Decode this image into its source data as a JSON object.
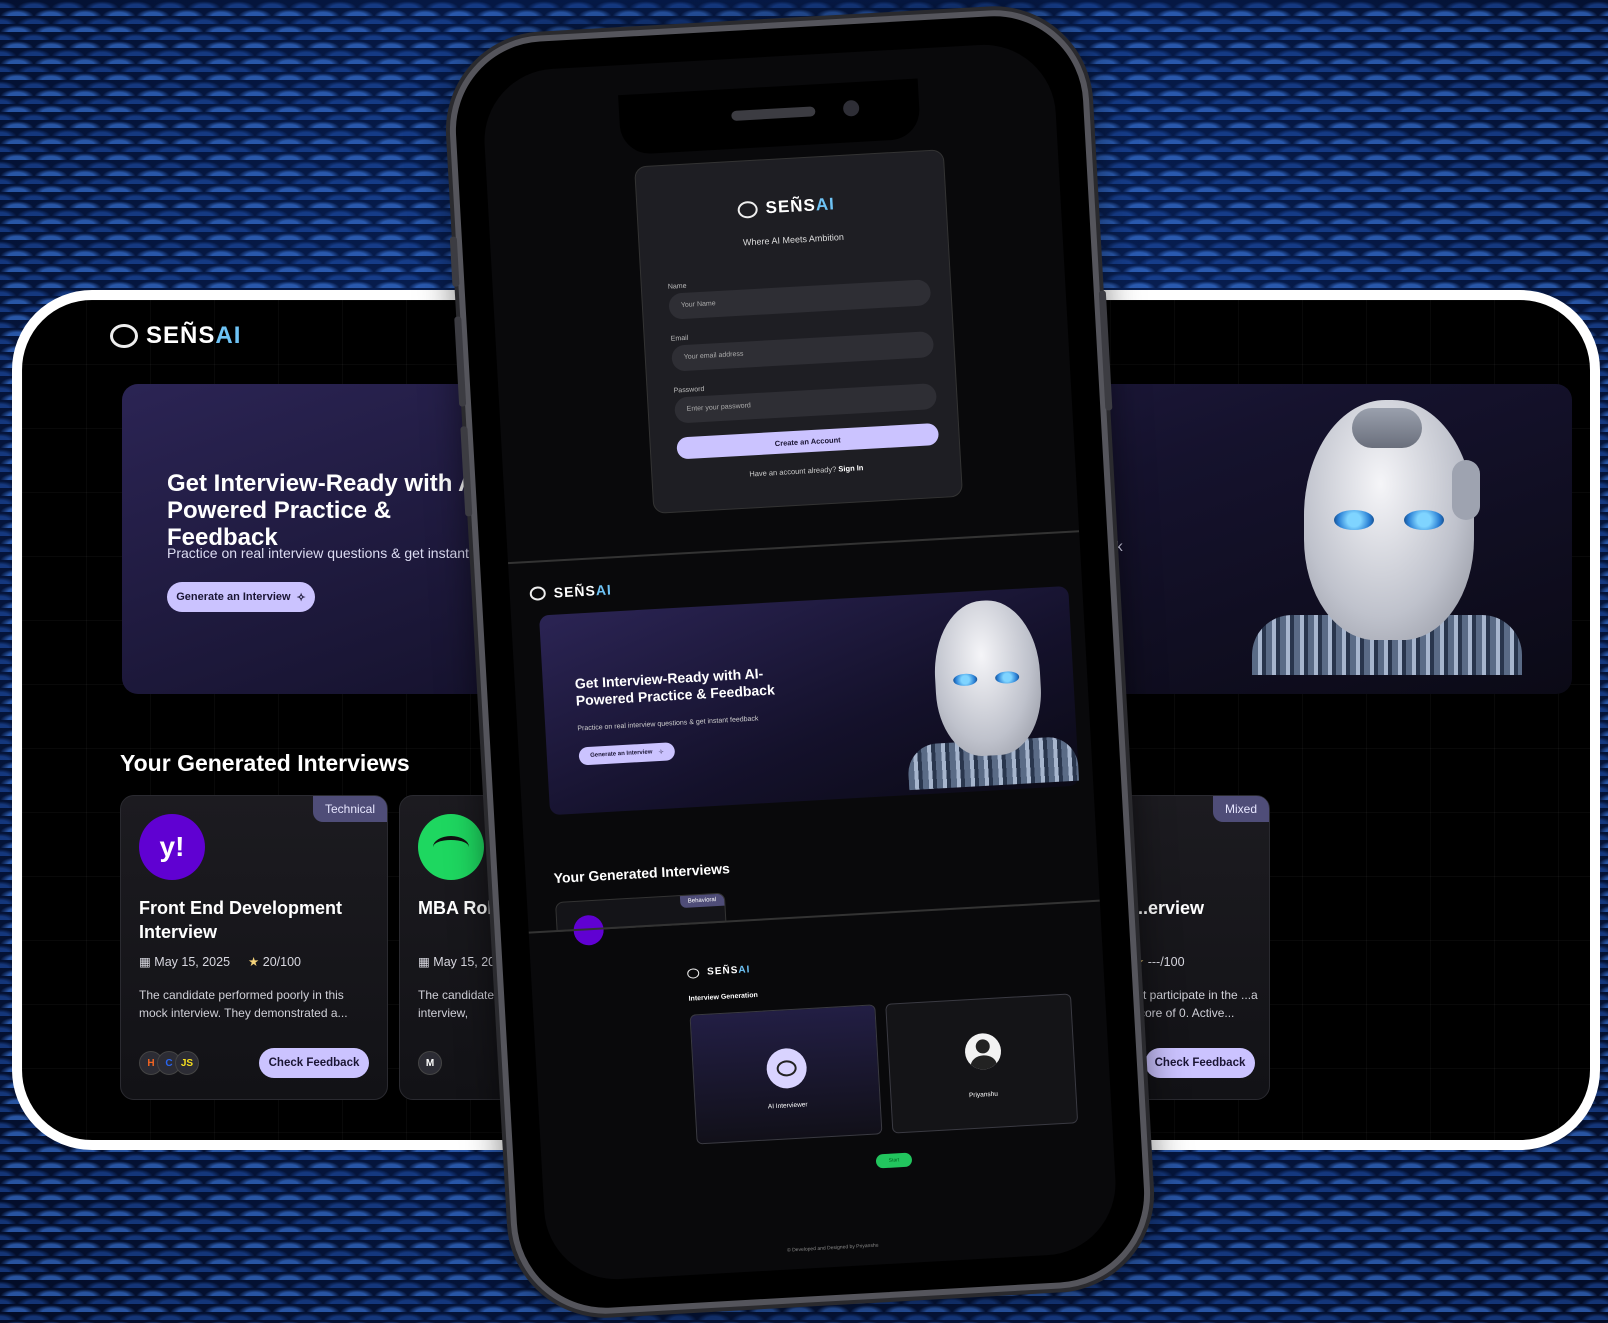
{
  "brand": {
    "name_a": "SEÑS",
    "name_b": "AI"
  },
  "hero": {
    "title": "Get Interview-Ready with AI-Powered Practice & Feedback",
    "subtitle": "Practice on real interview questions & get instant feedback",
    "cta": "Generate an Interview"
  },
  "interviews_section": {
    "title": "Your Generated Interviews"
  },
  "cards": [
    {
      "tag": "Technical",
      "logo": "y!",
      "title": "Front End Development Interview",
      "date": "May 15, 2025",
      "score": "20/100",
      "desc": "The candidate performed poorly in this mock interview. They demonstrated a...",
      "tech": [
        "H",
        "C",
        "JS"
      ],
      "button": "Check Feedback"
    },
    {
      "tag": "",
      "logo": "spotify-icon",
      "title": "MBA Role",
      "date": "May 15, 2025",
      "score": "",
      "desc": "The candidate d... interview, resultin...",
      "tech": [
        "M"
      ],
      "button": ""
    },
    {
      "tag": "Mixed",
      "logo": "",
      "title": "...erview",
      "date": "",
      "score": "---/100",
      "desc": "...t participate in the ...a score of 0. Active...",
      "tech": [],
      "button": "Check Feedback"
    }
  ],
  "hero_fragment": "...ck",
  "phone": {
    "auth": {
      "tagline": "Where AI Meets Ambition",
      "name_label": "Name",
      "name_placeholder": "Your Name",
      "email_label": "Email",
      "email_placeholder": "Your email address",
      "password_label": "Password",
      "password_placeholder": "Enter your password",
      "submit": "Create an Account",
      "footer_text": "Have an account already?",
      "footer_link": "Sign In"
    },
    "dashboard": {
      "tag": "Behavioral"
    },
    "interview": {
      "heading": "Interview Generation",
      "ai_label": "AI Interviewer",
      "user_label": "Priyanshu",
      "call_button": "Start"
    },
    "footer": "© Developed and Designed by Priyanshu"
  },
  "colors": {
    "accent": "#cbc3ff",
    "ai_text": "#6ec3f5",
    "call": "#22c55e",
    "yahoo": "#6001d2",
    "spotify": "#1ed760"
  }
}
